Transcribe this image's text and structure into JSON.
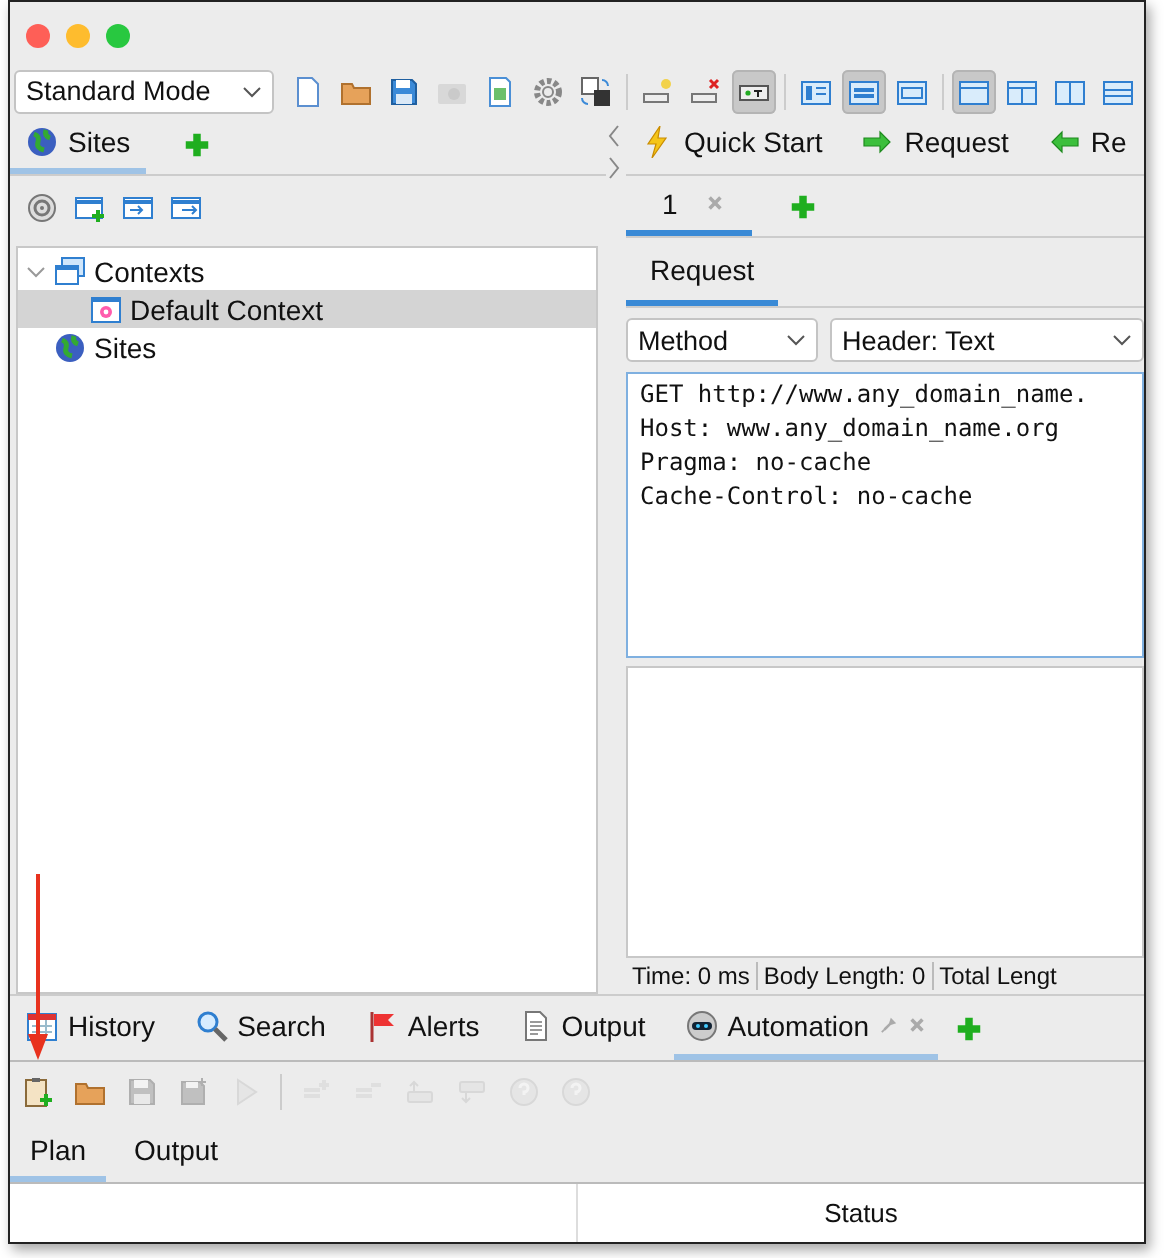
{
  "toolbar": {
    "mode": "Standard Mode",
    "groups": [
      [
        {
          "kind": "page",
          "pressed": false,
          "disabled": false
        },
        {
          "kind": "folder",
          "pressed": false,
          "disabled": false
        },
        {
          "kind": "save",
          "pressed": false,
          "disabled": false
        },
        {
          "kind": "camera",
          "pressed": false,
          "disabled": true
        },
        {
          "kind": "sheet",
          "pressed": false,
          "disabled": false
        },
        {
          "kind": "gear",
          "pressed": false,
          "disabled": false
        },
        {
          "kind": "swap",
          "pressed": false,
          "disabled": false
        }
      ],
      [
        {
          "kind": "bulb",
          "pressed": false,
          "disabled": false
        },
        {
          "kind": "tagx",
          "pressed": false,
          "disabled": false
        },
        {
          "kind": "tagt",
          "pressed": true,
          "disabled": false
        }
      ],
      [
        {
          "kind": "lay1",
          "pressed": false,
          "disabled": false
        },
        {
          "kind": "lay2",
          "pressed": true,
          "disabled": false
        },
        {
          "kind": "lay3",
          "pressed": false,
          "disabled": false
        }
      ],
      [
        {
          "kind": "lay4",
          "pressed": true,
          "disabled": false
        },
        {
          "kind": "lay5",
          "pressed": false,
          "disabled": false
        },
        {
          "kind": "lay6",
          "pressed": false,
          "disabled": false
        },
        {
          "kind": "lay7",
          "pressed": false,
          "disabled": false
        }
      ]
    ]
  },
  "left_panel": {
    "tabs": [
      {
        "label": "Sites",
        "kind": "globe",
        "selected": true
      }
    ],
    "tools": [
      {
        "kind": "target"
      },
      {
        "kind": "winplus"
      },
      {
        "kind": "winin"
      },
      {
        "kind": "winout"
      }
    ],
    "tree": [
      {
        "label": "Contexts",
        "kind": "contexts",
        "expanded": true,
        "selected": false,
        "children": [
          {
            "label": "Default Context",
            "kind": "context",
            "selected": true
          }
        ]
      },
      {
        "label": "Sites",
        "kind": "globe",
        "selected": false
      }
    ]
  },
  "right_panel": {
    "tabs": [
      {
        "label": "Quick Start",
        "kind": "bolt"
      },
      {
        "label": "Request",
        "kind": "right"
      },
      {
        "label": "Re",
        "kind": "left"
      }
    ],
    "request_tabs": [
      {
        "label": "1",
        "selected": true
      }
    ],
    "sub_tabs": [
      {
        "label": "Request",
        "selected": true
      }
    ],
    "method": "Method",
    "header_view": "Header: Text",
    "request_lines": [
      "GET http://www.any_domain_name.",
      "Host: www.any_domain_name.org",
      "Pragma: no-cache",
      "Cache-Control: no-cache"
    ],
    "status": [
      "Time: 0 ms",
      "Body Length: 0",
      "Total Lengt"
    ]
  },
  "bottom_panel": {
    "tabs": [
      {
        "label": "History",
        "kind": "calendar",
        "selected": false,
        "pinned": false
      },
      {
        "label": "Search",
        "kind": "magnifier",
        "selected": false,
        "pinned": false
      },
      {
        "label": "Alerts",
        "kind": "flag",
        "selected": false,
        "pinned": false
      },
      {
        "label": "Output",
        "kind": "doc",
        "selected": false,
        "pinned": false
      },
      {
        "label": "Automation",
        "kind": "robot",
        "selected": true,
        "pinned": true
      }
    ],
    "toolbar": [
      [
        {
          "kind": "clip",
          "disabled": false
        },
        {
          "kind": "folder",
          "disabled": false
        },
        {
          "kind": "save",
          "disabled": true
        },
        {
          "kind": "saveas",
          "disabled": true
        },
        {
          "kind": "play",
          "disabled": true
        }
      ],
      [
        {
          "kind": "listadd",
          "disabled": true
        },
        {
          "kind": "listrem",
          "disabled": true
        },
        {
          "kind": "up",
          "disabled": true
        },
        {
          "kind": "down",
          "disabled": true
        },
        {
          "kind": "helpadd",
          "disabled": true
        },
        {
          "kind": "helprem",
          "disabled": true
        }
      ]
    ],
    "sub_tabs": [
      {
        "label": "Plan",
        "selected": true
      },
      {
        "label": "Output",
        "selected": false
      }
    ],
    "table": {
      "columns": [
        "Status"
      ]
    }
  }
}
